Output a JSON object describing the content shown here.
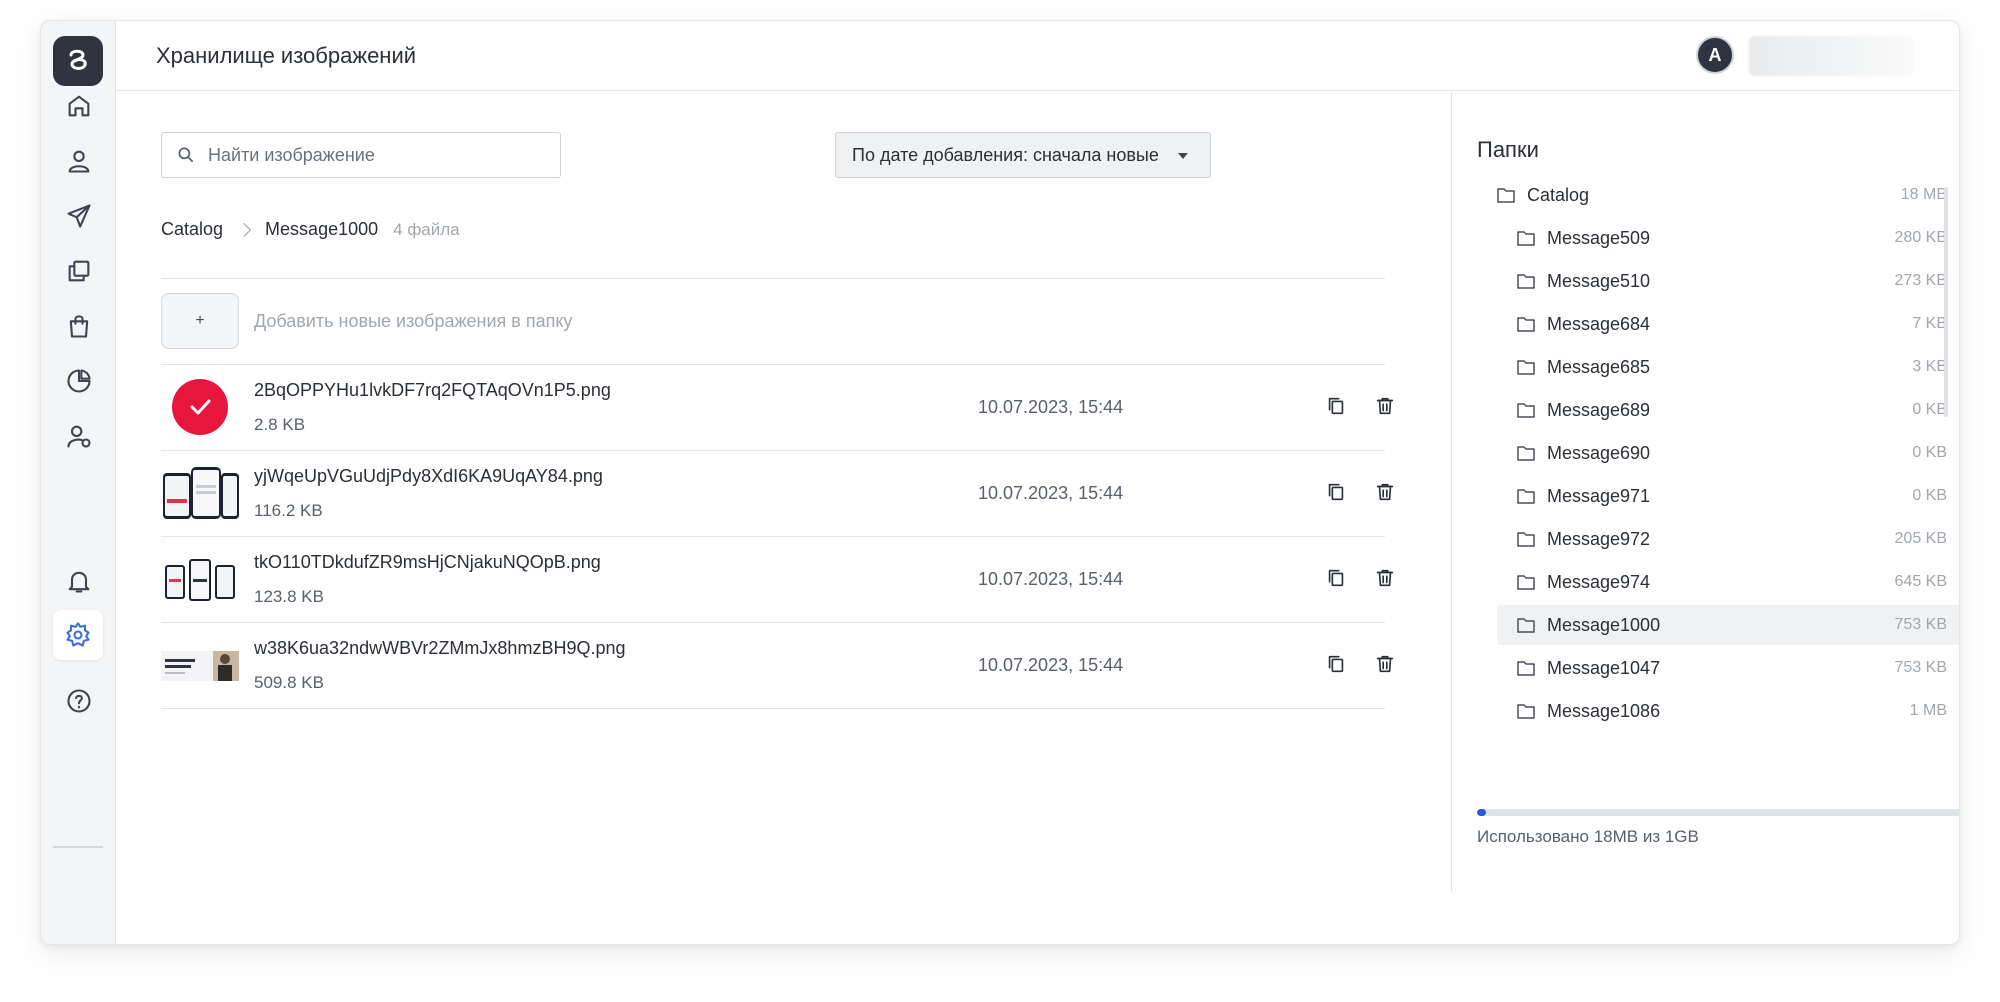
{
  "header": {
    "title": "Хранилище изображений",
    "avatar_initial": "A"
  },
  "sidebar": {
    "items": [
      {
        "name": "home-icon"
      },
      {
        "name": "user-icon"
      },
      {
        "name": "send-icon"
      },
      {
        "name": "copy-icon"
      },
      {
        "name": "shopping-bag-icon"
      },
      {
        "name": "pie-chart-icon"
      },
      {
        "name": "user-settings-icon"
      },
      {
        "name": "bell-icon"
      },
      {
        "name": "gear-icon",
        "active": true
      },
      {
        "name": "help-icon"
      }
    ]
  },
  "toolbar": {
    "search_placeholder": "Найти изображение",
    "sort_label": "По дате добавления: сначала новые"
  },
  "breadcrumb": {
    "root": "Catalog",
    "current": "Message1000",
    "count": "4 файла"
  },
  "add": {
    "button_label": "+",
    "text": "Добавить новые изображения в папку"
  },
  "files": [
    {
      "name": "2BqOPPYHu1lvkDF7rq2FQTAqOVn1P5.png",
      "size": "2.8 KB",
      "date": "10.07.2023, 15:44",
      "thumb": "check"
    },
    {
      "name": "yjWqeUpVGuUdjPdy8XdI6KA9UqAY84.png",
      "size": "116.2 KB",
      "date": "10.07.2023, 15:44",
      "thumb": "phones"
    },
    {
      "name": "tkO110TDkdufZR9msHjCNjakuNQOpB.png",
      "size": "123.8 KB",
      "date": "10.07.2023, 15:44",
      "thumb": "phones-small"
    },
    {
      "name": "w38K6ua32ndwWBVr2ZMmJx8hmzBH9Q.png",
      "size": "509.8 KB",
      "date": "10.07.2023, 15:44",
      "thumb": "banner"
    }
  ],
  "folders": {
    "title": "Папки",
    "items": [
      {
        "name": "Catalog",
        "size": "18 MB",
        "level": 0
      },
      {
        "name": "Message509",
        "size": "280 KB",
        "level": 1
      },
      {
        "name": "Message510",
        "size": "273 KB",
        "level": 1
      },
      {
        "name": "Message684",
        "size": "7 KB",
        "level": 1
      },
      {
        "name": "Message685",
        "size": "3 KB",
        "level": 1
      },
      {
        "name": "Message689",
        "size": "0 KB",
        "level": 1
      },
      {
        "name": "Message690",
        "size": "0 KB",
        "level": 1
      },
      {
        "name": "Message971",
        "size": "0 KB",
        "level": 1
      },
      {
        "name": "Message972",
        "size": "205 KB",
        "level": 1
      },
      {
        "name": "Message974",
        "size": "645 KB",
        "level": 1
      },
      {
        "name": "Message1000",
        "size": "753 KB",
        "level": 1,
        "selected": true
      },
      {
        "name": "Message1047",
        "size": "753 KB",
        "level": 1
      },
      {
        "name": "Message1086",
        "size": "1 MB",
        "level": 1
      }
    ]
  },
  "usage": {
    "text": "Использовано 18MB из 1GB",
    "fraction": 0.018
  },
  "colors": {
    "accent": "#3b6fd8",
    "check": "#e8163d",
    "usage": "#2b58d6"
  }
}
